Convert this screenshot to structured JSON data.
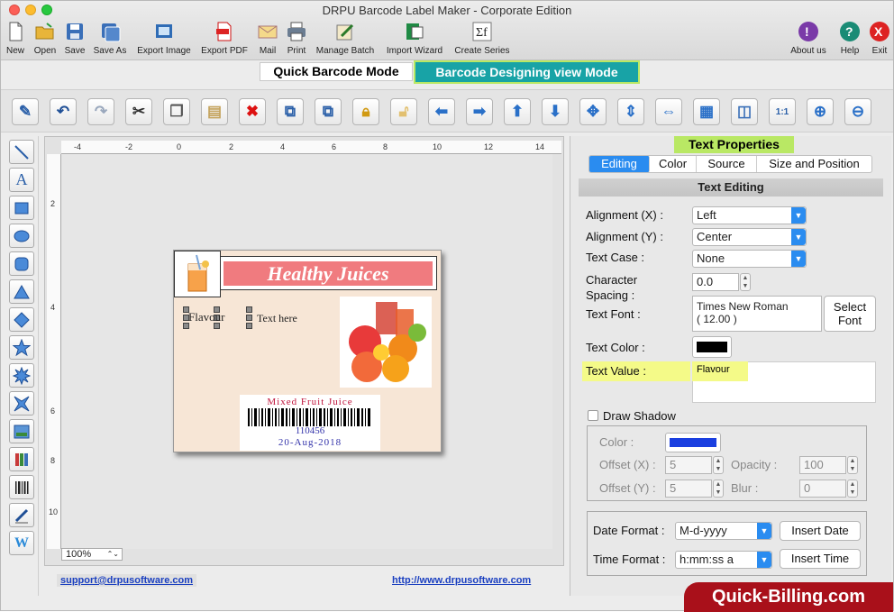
{
  "window": {
    "title": "DRPU Barcode Label Maker - Corporate Edition"
  },
  "toolbar": {
    "items": [
      {
        "label": "New"
      },
      {
        "label": "Open"
      },
      {
        "label": "Save"
      },
      {
        "label": "Save As"
      },
      {
        "label": "Export Image"
      },
      {
        "label": "Export PDF"
      },
      {
        "label": "Mail"
      },
      {
        "label": "Print"
      },
      {
        "label": "Manage Batch"
      },
      {
        "label": "Import Wizard"
      },
      {
        "label": "Create Series"
      },
      {
        "label": "About us"
      },
      {
        "label": "Help"
      },
      {
        "label": "Exit"
      }
    ]
  },
  "modes": {
    "quick": "Quick Barcode Mode",
    "designing": "Barcode Designing view Mode"
  },
  "canvas": {
    "zoom": "100%",
    "hruler_ticks": [
      "-4",
      "-2",
      "0",
      "2",
      "4",
      "6",
      "8",
      "10",
      "12",
      "14"
    ],
    "vruler_ticks": [
      "2",
      "4",
      "6",
      "8",
      "10"
    ]
  },
  "label": {
    "title": "Healthy Juices",
    "flavour": "Flavour",
    "text_here": "Text here",
    "barcode_caption": "Mixed Fruit Juice",
    "barcode_number": "110456",
    "barcode_date": "20-Aug-2018"
  },
  "footer": {
    "support_email": "support@drpusoftware.com",
    "website": "http://www.drpusoftware.com"
  },
  "panel": {
    "header": "Text Properties",
    "tabs": [
      "Editing",
      "Color",
      "Source",
      "Size and Position"
    ],
    "active_tab": "Editing",
    "section_title": "Text Editing",
    "alignment_x_label": "Alignment (X) :",
    "alignment_x_value": "Left",
    "alignment_y_label": "Alignment (Y) :",
    "alignment_y_value": "Center",
    "text_case_label": "Text Case :",
    "text_case_value": "None",
    "char_spacing_label_1": "Character",
    "char_spacing_label_2": "Spacing :",
    "char_spacing_value": "0.0",
    "text_font_label": "Text Font :",
    "text_font_value": "Times New Roman",
    "text_font_size": "( 12.00 )",
    "select_font_label_1": "Select",
    "select_font_label_2": "Font",
    "text_color_label": "Text Color :",
    "text_color_value": "#000000",
    "text_value_label": "Text Value :",
    "text_value": "Flavour",
    "draw_shadow_label": "Draw Shadow",
    "shadow_color_label": "Color :",
    "shadow_color_value": "#1a3fe0",
    "offset_x_label": "Offset (X) :",
    "offset_x_value": "5",
    "offset_y_label": "Offset (Y) :",
    "offset_y_value": "5",
    "opacity_label": "Opacity :",
    "opacity_value": "100",
    "blur_label": "Blur :",
    "blur_value": "0",
    "date_format_label": "Date Format :",
    "date_format_value": "M-d-yyyy",
    "insert_date_label": "Insert Date",
    "time_format_label": "Time Format :",
    "time_format_value": "h:mm:ss a",
    "insert_time_label": "Insert Time"
  },
  "brand": {
    "text": "Quick-Billing.com"
  },
  "colors": {
    "accent": "#2a8cf0",
    "mode_active": "#18a3a6",
    "highlight": "#b9e864",
    "title_fill": "#f07b7f"
  }
}
